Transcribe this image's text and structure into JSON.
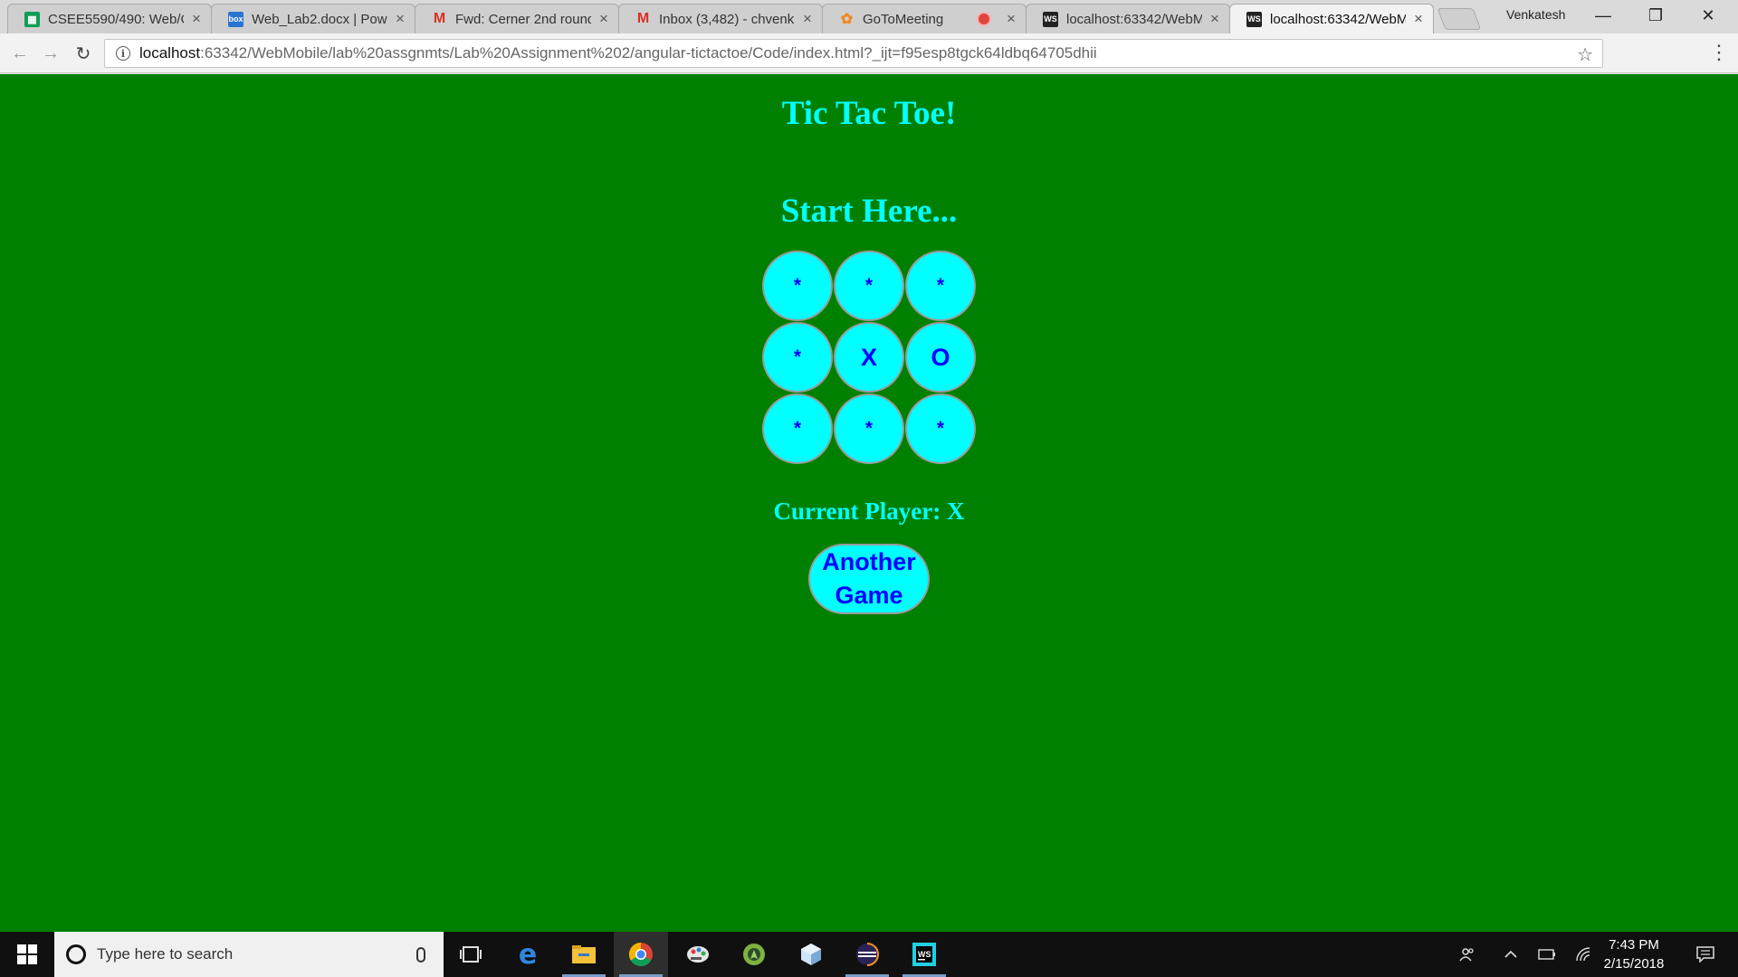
{
  "browser": {
    "tabs": [
      {
        "title": "CSEE5590/490: Web/C",
        "icon": "sheets-icon",
        "color": "#0f9d58"
      },
      {
        "title": "Web_Lab2.docx | Powe",
        "icon": "box-icon",
        "color": "#2a74d1"
      },
      {
        "title": "Fwd: Cerner 2nd round",
        "icon": "gmail-icon",
        "color": "#d93025"
      },
      {
        "title": "Inbox (3,482) - chvenk",
        "icon": "gmail-icon",
        "color": "#d93025"
      },
      {
        "title": "GoToMeeting",
        "icon": "gotomeeting-icon",
        "color": "#f08a24"
      },
      {
        "title": "localhost:63342/WebM",
        "icon": "webstorm-icon",
        "color": "#222222"
      },
      {
        "title": "localhost:63342/WebM",
        "icon": "webstorm-icon",
        "color": "#222222"
      }
    ],
    "profile_name": "Venkatesh",
    "url_host": "localhost",
    "url_rest": ":63342/WebMobile/lab%20assgnmts/Lab%20Assignment%202/angular-tictactoe/Code/index.html?_ijt=f95esp8tgck64ldbq64705dhii"
  },
  "game": {
    "title": "Tic Tac Toe!",
    "start_text": "Start Here...",
    "cells": [
      "*",
      "*",
      "*",
      "*",
      "X",
      "O",
      "*",
      "*",
      "*"
    ],
    "current_player": "Current Player: X",
    "another_game_label": "Another Game"
  },
  "colors": {
    "page_background": "#008000",
    "accent_text": "#00ffff",
    "cell_fill": "#00ffff",
    "cell_text": "#0000ff"
  },
  "taskbar": {
    "search_placeholder": "Type here to search",
    "pinned": [
      "task-view-icon",
      "edge-icon",
      "file-explorer-icon",
      "chrome-icon",
      "paint-icon",
      "android-studio-icon",
      "cube-app-icon",
      "eclipse-icon",
      "webstorm-icon"
    ],
    "time": "7:43 PM",
    "date": "2/15/2018"
  }
}
